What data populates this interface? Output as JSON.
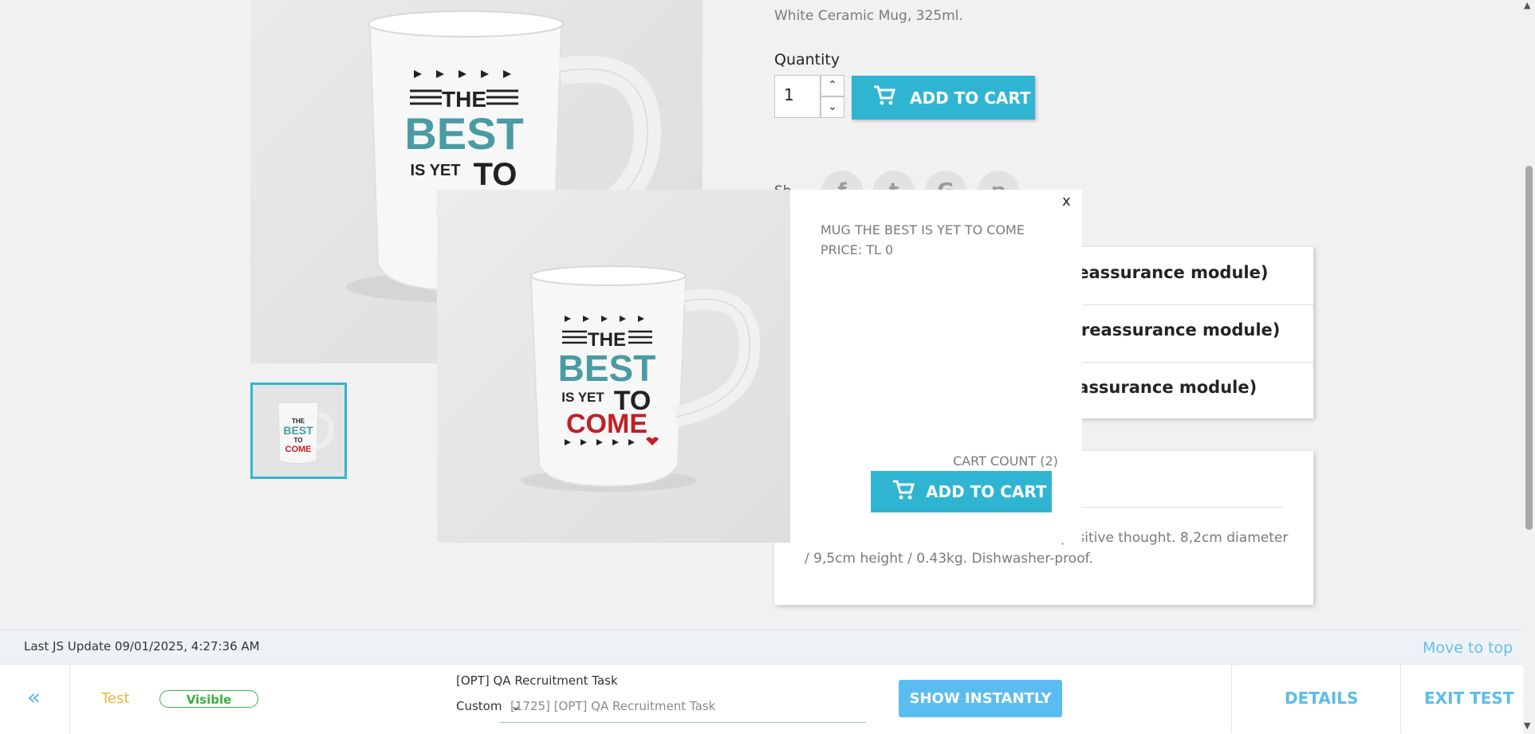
{
  "product": {
    "short_description": "White Ceramic Mug, 325ml.",
    "quantity_label": "Quantity",
    "quantity_value": "1",
    "add_to_cart": "ADD TO CART",
    "share_label": "Sh"
  },
  "mug_art": {
    "line1": "THE",
    "line2": "BEST",
    "line3": "IS YET",
    "line4": "TO",
    "line5": "COME"
  },
  "reassurance": [
    {
      "label": "er reassurance module)"
    },
    {
      "label": "ner reassurance module)"
    },
    {
      "label": "r reassurance module)"
    }
  ],
  "details": {
    "text": "… … … … … … … … … … …nt with a positive thought. 8,2cm diameter / 9,5cm height / 0.43kg. Dishwasher-proof."
  },
  "popup": {
    "close": "x",
    "name": "MUG THE BEST IS YET TO COME",
    "price": "PRICE: TL 0",
    "cart_count": "CART COUNT (2)",
    "add_to_cart": "ADD TO CART"
  },
  "status": {
    "last_update": "Last JS Update 09/01/2025, 4:27:36 AM",
    "move_to_top": "Move to top"
  },
  "toolbar": {
    "back": "«",
    "test_label": "Test",
    "visible_badge": "Visible",
    "task_title": "[OPT] QA Recruitment Task",
    "custom_label": "Custom",
    "task_select_value": "[1725] [OPT] QA Recruitment Task",
    "show_instantly": "SHOW INSTANTLY",
    "details": "DETAILS",
    "exit_test": "EXIT TEST"
  },
  "colors": {
    "accent": "#2fb5d2",
    "mug_teal": "#4a9ba3",
    "mug_red": "#c0202a",
    "visible_green": "#3cb043",
    "test_orange": "#f2b33d"
  }
}
